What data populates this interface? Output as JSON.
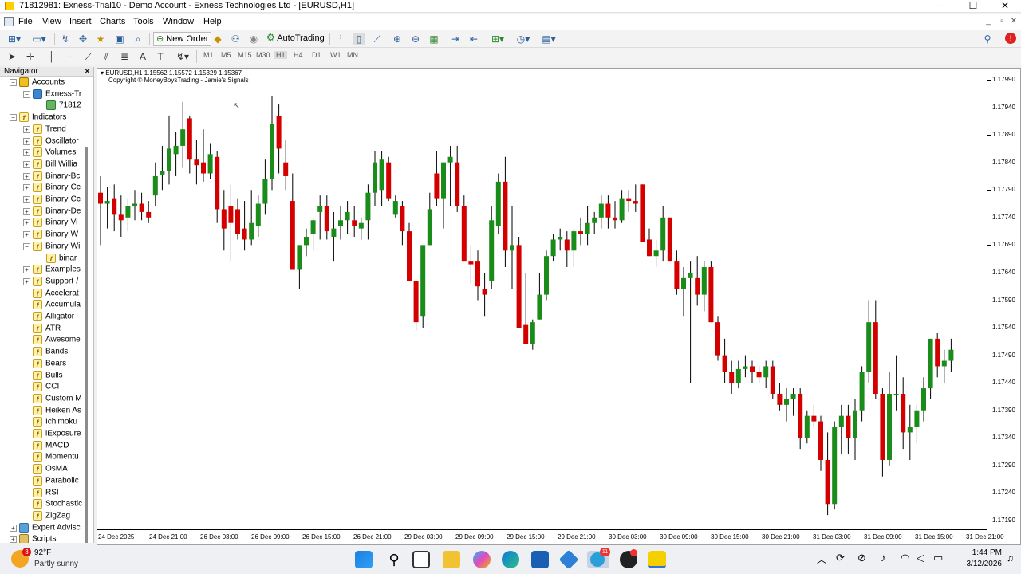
{
  "window": {
    "title": "71812981: Exness-Trial10 - Demo Account - Exness Technologies Ltd - [EURUSD,H1]",
    "minimize": "─",
    "maximize": "☐",
    "close": "✕"
  },
  "menu": [
    "File",
    "View",
    "Insert",
    "Charts",
    "Tools",
    "Window",
    "Help"
  ],
  "toolbar": {
    "new_order": "New Order",
    "autotrading": "AutoTrading"
  },
  "timeframes": [
    "M1",
    "M5",
    "M15",
    "M30",
    "H1",
    "H4",
    "D1",
    "W1",
    "MN"
  ],
  "active_timeframe": "H1",
  "navigator": {
    "title": "Navigator",
    "close": "✕",
    "items": [
      {
        "label": "Accounts",
        "level": 0,
        "icon": "acc",
        "exp": "⊟"
      },
      {
        "label": "Exness-Tr",
        "level": 1,
        "icon": "srv",
        "exp": "⊟"
      },
      {
        "label": "71812",
        "level": 2,
        "icon": "user",
        "exp": ""
      },
      {
        "label": "Indicators",
        "level": 0,
        "icon": "f",
        "exp": "⊟"
      },
      {
        "label": "Trend",
        "level": 1,
        "icon": "f",
        "exp": "⊞"
      },
      {
        "label": "Oscillator",
        "level": 1,
        "icon": "f",
        "exp": "⊞"
      },
      {
        "label": "Volumes",
        "level": 1,
        "icon": "f",
        "exp": "⊞"
      },
      {
        "label": "Bill Willia",
        "level": 1,
        "icon": "f",
        "exp": "⊞"
      },
      {
        "label": "Binary-Bc",
        "level": 1,
        "icon": "f",
        "exp": "⊞"
      },
      {
        "label": "Binary-Cc",
        "level": 1,
        "icon": "f",
        "exp": "⊞"
      },
      {
        "label": "Binary-Cc",
        "level": 1,
        "icon": "f",
        "exp": "⊞"
      },
      {
        "label": "Binary-De",
        "level": 1,
        "icon": "f",
        "exp": "⊞"
      },
      {
        "label": "Binary-Vi",
        "level": 1,
        "icon": "f",
        "exp": "⊞"
      },
      {
        "label": "Binary-W",
        "level": 1,
        "icon": "f",
        "exp": "⊞"
      },
      {
        "label": "Binary-Wi",
        "level": 1,
        "icon": "f",
        "exp": "⊟"
      },
      {
        "label": "binar",
        "level": 2,
        "icon": "f",
        "exp": ""
      },
      {
        "label": "Examples",
        "level": 1,
        "icon": "f",
        "exp": "⊞"
      },
      {
        "label": "Support-/",
        "level": 1,
        "icon": "f",
        "exp": "⊞"
      },
      {
        "label": "Accelerat",
        "level": 1,
        "icon": "f",
        "exp": ""
      },
      {
        "label": "Accumula",
        "level": 1,
        "icon": "f",
        "exp": ""
      },
      {
        "label": "Alligator",
        "level": 1,
        "icon": "f",
        "exp": ""
      },
      {
        "label": "ATR",
        "level": 1,
        "icon": "f",
        "exp": ""
      },
      {
        "label": "Awesome",
        "level": 1,
        "icon": "f",
        "exp": ""
      },
      {
        "label": "Bands",
        "level": 1,
        "icon": "f",
        "exp": ""
      },
      {
        "label": "Bears",
        "level": 1,
        "icon": "f",
        "exp": ""
      },
      {
        "label": "Bulls",
        "level": 1,
        "icon": "f",
        "exp": ""
      },
      {
        "label": "CCI",
        "level": 1,
        "icon": "f",
        "exp": ""
      },
      {
        "label": "Custom M",
        "level": 1,
        "icon": "f",
        "exp": ""
      },
      {
        "label": "Heiken As",
        "level": 1,
        "icon": "f",
        "exp": ""
      },
      {
        "label": "Ichimoku",
        "level": 1,
        "icon": "f",
        "exp": ""
      },
      {
        "label": "iExposure",
        "level": 1,
        "icon": "f",
        "exp": ""
      },
      {
        "label": "MACD",
        "level": 1,
        "icon": "f",
        "exp": ""
      },
      {
        "label": "Momentu",
        "level": 1,
        "icon": "f",
        "exp": ""
      },
      {
        "label": "OsMA",
        "level": 1,
        "icon": "f",
        "exp": ""
      },
      {
        "label": "Parabolic",
        "level": 1,
        "icon": "f",
        "exp": ""
      },
      {
        "label": "RSI",
        "level": 1,
        "icon": "f",
        "exp": ""
      },
      {
        "label": "Stochastic",
        "level": 1,
        "icon": "f",
        "exp": ""
      },
      {
        "label": "ZigZag",
        "level": 1,
        "icon": "f",
        "exp": ""
      },
      {
        "label": "Expert Advisc",
        "level": 0,
        "icon": "ea",
        "exp": "⊞"
      },
      {
        "label": "Scripts",
        "level": 0,
        "icon": "scr",
        "exp": "⊞"
      }
    ]
  },
  "chart": {
    "info_line1": "EURUSD,H1  1.15562 1.15572 1.15329 1.15367",
    "info_line2": "Copyright © MoneyBoysTrading - Jamie's Signals",
    "bull_color": "#1a8c1a",
    "bear_color": "#d40000"
  },
  "chart_data": {
    "type": "candlestick",
    "symbol": "EURUSD",
    "timeframe": "H1",
    "yticks": [
      "1.17990",
      "1.17940",
      "1.17890",
      "1.17840",
      "1.17790",
      "1.17740",
      "1.17690",
      "1.17640",
      "1.17590",
      "1.17540",
      "1.17490",
      "1.17440",
      "1.17390",
      "1.17340",
      "1.17290",
      "1.17240",
      "1.17190"
    ],
    "ylim": [
      1.17185,
      1.17998
    ],
    "xticks": [
      "24 Dec 2025",
      "24 Dec 21:00",
      "26 Dec 03:00",
      "26 Dec 09:00",
      "26 Dec 15:00",
      "26 Dec 21:00",
      "29 Dec 03:00",
      "29 Dec 09:00",
      "29 Dec 15:00",
      "29 Dec 21:00",
      "30 Dec 03:00",
      "30 Dec 09:00",
      "30 Dec 15:00",
      "30 Dec 21:00",
      "31 Dec 03:00",
      "31 Dec 09:00",
      "31 Dec 15:00",
      "31 Dec 21:00"
    ],
    "candles": [
      [
        1.17785,
        1.17815,
        1.1769,
        1.17765
      ],
      [
        1.17765,
        1.17795,
        1.1772,
        1.1777
      ],
      [
        1.17775,
        1.178,
        1.17715,
        1.17745
      ],
      [
        1.17745,
        1.1778,
        1.17705,
        1.17735
      ],
      [
        1.1774,
        1.17775,
        1.17715,
        1.1776
      ],
      [
        1.1776,
        1.1779,
        1.17735,
        1.17765
      ],
      [
        1.17765,
        1.17785,
        1.17735,
        1.1775
      ],
      [
        1.1775,
        1.1777,
        1.1773,
        1.1774
      ],
      [
        1.1778,
        1.1784,
        1.1776,
        1.17815
      ],
      [
        1.17818,
        1.1787,
        1.1779,
        1.17825
      ],
      [
        1.17825,
        1.17925,
        1.178,
        1.17865
      ],
      [
        1.17855,
        1.17895,
        1.17815,
        1.1787
      ],
      [
        1.1787,
        1.1795,
        1.1783,
        1.179
      ],
      [
        1.1792,
        1.17925,
        1.1782,
        1.17845
      ],
      [
        1.17845,
        1.1788,
        1.178,
        1.17835
      ],
      [
        1.1784,
        1.179,
        1.17805,
        1.1782
      ],
      [
        1.1782,
        1.17875,
        1.1781,
        1.17855
      ],
      [
        1.1785,
        1.1786,
        1.1773,
        1.17755
      ],
      [
        1.17755,
        1.1779,
        1.1768,
        1.1772
      ],
      [
        1.1776,
        1.178,
        1.1766,
        1.1773
      ],
      [
        1.17755,
        1.17775,
        1.177,
        1.1771
      ],
      [
        1.1772,
        1.1777,
        1.1768,
        1.177
      ],
      [
        1.177,
        1.1779,
        1.1769,
        1.1773
      ],
      [
        1.17725,
        1.1778,
        1.17705,
        1.17765
      ],
      [
        1.17765,
        1.17845,
        1.17745,
        1.1781
      ],
      [
        1.1781,
        1.1796,
        1.1779,
        1.1791
      ],
      [
        1.17925,
        1.17945,
        1.1782,
        1.17865
      ],
      [
        1.1784,
        1.1788,
        1.1779,
        1.17815
      ],
      [
        1.1777,
        1.1782,
        1.1765,
        1.17645
      ],
      [
        1.17645,
        1.1768,
        1.1761,
        1.1769
      ],
      [
        1.1769,
        1.1772,
        1.1767,
        1.17705
      ],
      [
        1.1771,
        1.1774,
        1.1768,
        1.17735
      ],
      [
        1.1775,
        1.1778,
        1.177,
        1.1776
      ],
      [
        1.1776,
        1.1778,
        1.177,
        1.17715
      ],
      [
        1.17705,
        1.1775,
        1.1766,
        1.1772
      ],
      [
        1.17725,
        1.1776,
        1.177,
        1.17735
      ],
      [
        1.17735,
        1.1777,
        1.1771,
        1.1775
      ],
      [
        1.17735,
        1.1776,
        1.17705,
        1.17725
      ],
      [
        1.1772,
        1.1774,
        1.177,
        1.1773
      ],
      [
        1.17735,
        1.178,
        1.177,
        1.17785
      ],
      [
        1.17785,
        1.1786,
        1.1776,
        1.1784
      ],
      [
        1.1779,
        1.1786,
        1.1776,
        1.17845
      ],
      [
        1.1784,
        1.1785,
        1.1777,
        1.17775
      ],
      [
        1.17745,
        1.1778,
        1.1774,
        1.1777
      ],
      [
        1.1776,
        1.1777,
        1.1769,
        1.17715
      ],
      [
        1.17715,
        1.1773,
        1.1764,
        1.17625
      ],
      [
        1.17625,
        1.1757,
        1.17535,
        1.1755
      ],
      [
        1.1756,
        1.1759,
        1.1754,
        1.1769
      ],
      [
        1.1769,
        1.17785,
        1.1769,
        1.17755
      ],
      [
        1.1782,
        1.1786,
        1.1776,
        1.17775
      ],
      [
        1.17775,
        1.178,
        1.1772,
        1.1784
      ],
      [
        1.1784,
        1.1787,
        1.1776,
        1.1785
      ],
      [
        1.1784,
        1.1787,
        1.1775,
        1.1776
      ],
      [
        1.1776,
        1.1778,
        1.1768,
        1.1766
      ],
      [
        1.1766,
        1.1769,
        1.1762,
        1.17655
      ],
      [
        1.1766,
        1.1768,
        1.1759,
        1.17615
      ],
      [
        1.1761,
        1.1764,
        1.1756,
        1.176
      ],
      [
        1.17625,
        1.1776,
        1.1761,
        1.17735
      ],
      [
        1.17725,
        1.1782,
        1.1771,
        1.17805
      ],
      [
        1.17805,
        1.1785,
        1.1765,
        1.1768
      ],
      [
        1.1768,
        1.1776,
        1.1761,
        1.1769
      ],
      [
        1.1769,
        1.17705,
        1.1755,
        1.1754
      ],
      [
        1.17545,
        1.1764,
        1.1751,
        1.1751
      ],
      [
        1.1751,
        1.17555,
        1.175,
        1.1755
      ],
      [
        1.17555,
        1.1764,
        1.1756,
        1.176
      ],
      [
        1.176,
        1.1768,
        1.1759,
        1.1767
      ],
      [
        1.1767,
        1.1771,
        1.1766,
        1.177
      ],
      [
        1.177,
        1.1772,
        1.1768,
        1.17705
      ],
      [
        1.177,
        1.17715,
        1.1765,
        1.1768
      ],
      [
        1.1768,
        1.1772,
        1.1765,
        1.17715
      ],
      [
        1.17715,
        1.1774,
        1.1769,
        1.1771
      ],
      [
        1.1771,
        1.1776,
        1.1769,
        1.1773
      ],
      [
        1.1773,
        1.1775,
        1.1771,
        1.1774
      ],
      [
        1.1774,
        1.1778,
        1.1772,
        1.17765
      ],
      [
        1.17765,
        1.1778,
        1.1772,
        1.1774
      ],
      [
        1.1774,
        1.1777,
        1.1772,
        1.17735
      ],
      [
        1.17735,
        1.1779,
        1.1773,
        1.17775
      ],
      [
        1.17775,
        1.1779,
        1.1775,
        1.1777
      ],
      [
        1.1777,
        1.178,
        1.1775,
        1.17765
      ],
      [
        1.178,
        1.178,
        1.1771,
        1.17695
      ],
      [
        1.177,
        1.1772,
        1.1767,
        1.1767
      ],
      [
        1.1767,
        1.177,
        1.1765,
        1.1768
      ],
      [
        1.1768,
        1.1776,
        1.1766,
        1.1774
      ],
      [
        1.1774,
        1.1774,
        1.1768,
        1.1766
      ],
      [
        1.1766,
        1.1768,
        1.176,
        1.1761
      ],
      [
        1.1761,
        1.1765,
        1.1756,
        1.1763
      ],
      [
        1.1763,
        1.1766,
        1.1744,
        1.1764
      ],
      [
        1.1763,
        1.1767,
        1.1758,
        1.176
      ],
      [
        1.176,
        1.1766,
        1.1757,
        1.1765
      ],
      [
        1.1765,
        1.1766,
        1.1755,
        1.1755
      ],
      [
        1.1755,
        1.1756,
        1.1748,
        1.1749
      ],
      [
        1.1749,
        1.1752,
        1.1744,
        1.1746
      ],
      [
        1.1746,
        1.1748,
        1.1742,
        1.1744
      ],
      [
        1.1744,
        1.1748,
        1.1743,
        1.17465
      ],
      [
        1.17465,
        1.1749,
        1.1745,
        1.1747
      ],
      [
        1.1747,
        1.1748,
        1.1744,
        1.1746
      ],
      [
        1.1746,
        1.1747,
        1.1744,
        1.1745
      ],
      [
        1.1745,
        1.1748,
        1.1743,
        1.1747
      ],
      [
        1.1747,
        1.1748,
        1.1741,
        1.1742
      ],
      [
        1.1742,
        1.1744,
        1.1739,
        1.174
      ],
      [
        1.174,
        1.1743,
        1.1737,
        1.1741
      ],
      [
        1.1741,
        1.1743,
        1.1738,
        1.1742
      ],
      [
        1.1742,
        1.1743,
        1.1732,
        1.1734
      ],
      [
        1.1734,
        1.1739,
        1.1733,
        1.1738
      ],
      [
        1.1738,
        1.174,
        1.1736,
        1.1737
      ],
      [
        1.1737,
        1.1738,
        1.1728,
        1.173
      ],
      [
        1.173,
        1.1735,
        1.172,
        1.1722
      ],
      [
        1.1722,
        1.1737,
        1.1721,
        1.1736
      ],
      [
        1.1736,
        1.174,
        1.1731,
        1.1738
      ],
      [
        1.1738,
        1.174,
        1.1731,
        1.1734
      ],
      [
        1.1734,
        1.1741,
        1.173,
        1.1739
      ],
      [
        1.1739,
        1.1747,
        1.1737,
        1.1746
      ],
      [
        1.1746,
        1.1759,
        1.1744,
        1.1755
      ],
      [
        1.1755,
        1.1759,
        1.1741,
        1.1742
      ],
      [
        1.1742,
        1.1743,
        1.1727,
        1.173
      ],
      [
        1.173,
        1.1746,
        1.1729,
        1.1742
      ],
      [
        1.1742,
        1.1749,
        1.1739,
        1.1742
      ],
      [
        1.1742,
        1.1745,
        1.1732,
        1.1735
      ],
      [
        1.1735,
        1.174,
        1.173,
        1.1736
      ],
      [
        1.1736,
        1.174,
        1.1733,
        1.1739
      ],
      [
        1.1739,
        1.1745,
        1.1737,
        1.1743
      ],
      [
        1.1743,
        1.175,
        1.1741,
        1.1752
      ],
      [
        1.1752,
        1.1753,
        1.1745,
        1.1747
      ],
      [
        1.1747,
        1.175,
        1.1744,
        1.1748
      ],
      [
        1.1748,
        1.1752,
        1.1746,
        1.175
      ]
    ]
  },
  "taskbar": {
    "weather_temp": "92°F",
    "weather_desc": "Partly sunny",
    "weather_badge": "3",
    "time": "1:44 PM",
    "date": "3/12/2026",
    "telegram_badge": "11"
  }
}
